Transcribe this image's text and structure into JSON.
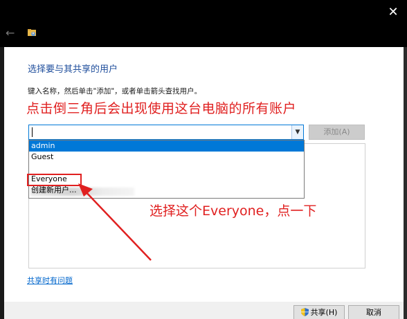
{
  "titlebar": {
    "close_glyph": "✕",
    "back_glyph": "←"
  },
  "dialog": {
    "heading": "选择要与其共享的用户",
    "instruction": "键入名称，然后单击\"添加\"，或者单击箭头查找用户。",
    "add_label": "添加(A)",
    "combo_value": "",
    "dropdown_items": [
      "admin",
      "Guest",
      "",
      "Everyone",
      "创建新用户..."
    ],
    "selected_item": "admin",
    "problem_link": "共享时有问题",
    "share_label": "共享(H)",
    "cancel_label": "取消"
  },
  "annotations": {
    "top_text": "点击倒三角后会出现使用这台电脑的所有账户",
    "bottom_text": "选择这个Everyone，点一下",
    "color": "#e02020"
  },
  "icons": {
    "close": "close-icon",
    "back": "back-arrow-icon",
    "folder": "folder-icon",
    "dropdown": "chevron-down-icon",
    "shield": "shield-icon"
  },
  "colors": {
    "accent": "#0078d7",
    "heading": "#1f4e9c",
    "link": "#0066cc"
  }
}
